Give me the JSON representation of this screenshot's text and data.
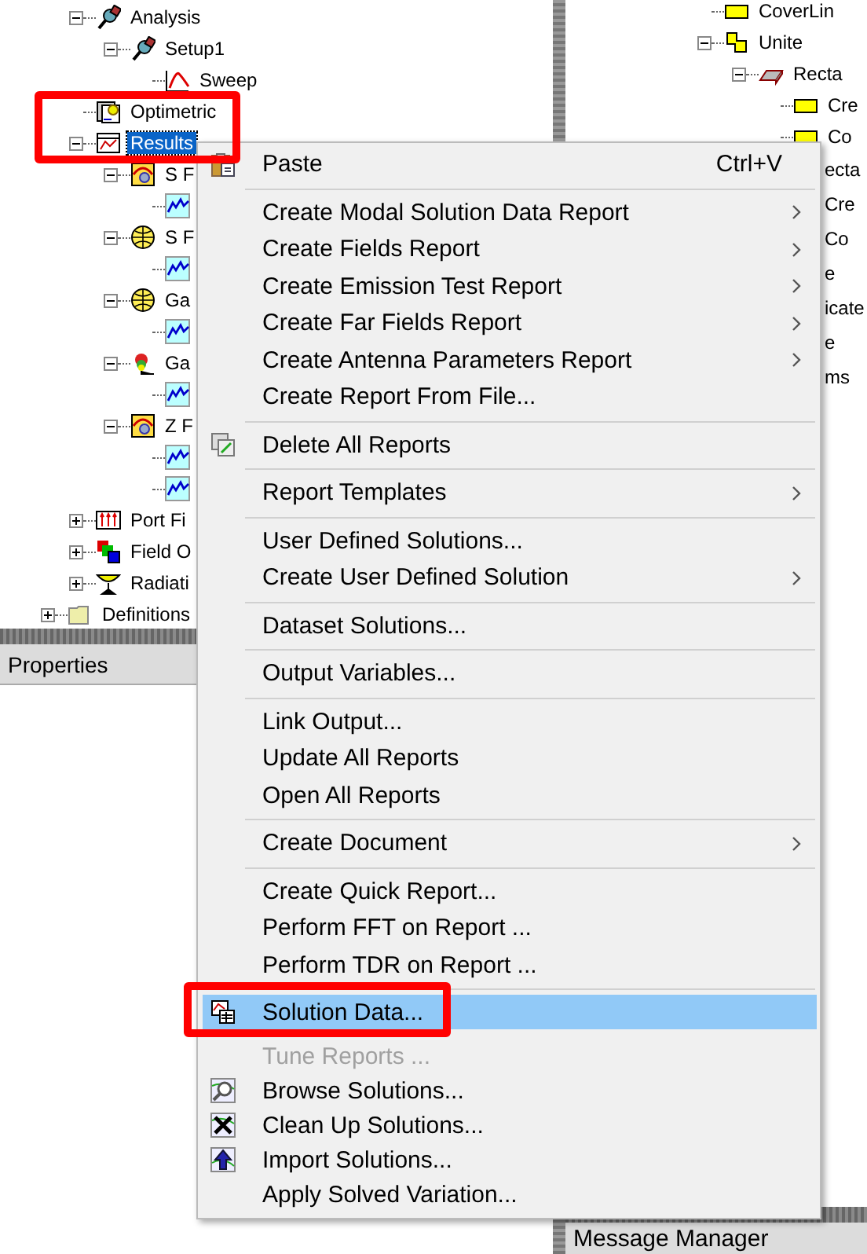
{
  "tree": {
    "items": [
      {
        "label": "Analysis",
        "kind": "probe",
        "expanded": true,
        "selected": false,
        "children": [
          {
            "label": "Setup1",
            "kind": "probe",
            "expanded": true,
            "selected": false,
            "children": [
              {
                "label": "Sweep",
                "kind": "sweep",
                "selected": false
              }
            ]
          }
        ]
      },
      {
        "label": "Optimetric",
        "kind": "optimetrics",
        "selected": false
      },
      {
        "label": "Results",
        "kind": "results",
        "expanded": true,
        "selected": true,
        "children": [
          {
            "label": "S F",
            "kind": "report",
            "expanded": true,
            "selected": false,
            "children": [
              {
                "kind": "plot",
                "selected": false
              }
            ]
          },
          {
            "label": "S F",
            "kind": "ball",
            "expanded": true,
            "selected": false,
            "children": [
              {
                "kind": "plot",
                "selected": false
              }
            ]
          },
          {
            "label": "Ga",
            "kind": "ball",
            "expanded": true,
            "selected": false,
            "children": [
              {
                "kind": "plot",
                "selected": false
              }
            ]
          },
          {
            "label": "Ga",
            "kind": "flower",
            "expanded": true,
            "selected": false,
            "children": [
              {
                "kind": "plot",
                "selected": false
              }
            ]
          },
          {
            "label": "Z F",
            "kind": "report",
            "expanded": true,
            "selected": false,
            "children": [
              {
                "kind": "plot",
                "selected": false
              },
              {
                "kind": "plot",
                "selected": false
              }
            ]
          }
        ]
      },
      {
        "label": "Port Fi",
        "kind": "ports",
        "expanded": false,
        "selected": false
      },
      {
        "label": "Field O",
        "kind": "field",
        "expanded": false,
        "selected": false
      },
      {
        "label": "Radiati",
        "kind": "radiation",
        "expanded": false,
        "selected": false
      }
    ],
    "outer_items": [
      {
        "label": "Definitions",
        "kind": "folder",
        "expanded": false,
        "selected": false
      }
    ]
  },
  "model_tree": {
    "items": [
      {
        "label": "CoverLin",
        "kind": "sheet"
      },
      {
        "label": "Unite",
        "kind": "unite",
        "expanded": true,
        "children": [
          {
            "label": "Recta",
            "kind": "box",
            "expanded": true,
            "children": [
              {
                "label": "Cre",
                "kind": "sheet"
              },
              {
                "label": "Co",
                "kind": "sheet"
              }
            ]
          }
        ]
      }
    ],
    "fragments": [
      "ecta",
      "Cre",
      "Co",
      "e",
      "icate",
      "e",
      "ms"
    ]
  },
  "properties": {
    "title": "Properties"
  },
  "message_manager": {
    "title": "Message Manager"
  },
  "context_menu": [
    {
      "kind": "paste",
      "label": "Paste",
      "shortcut": "Ctrl+V",
      "submenu": false,
      "selected": false,
      "disabled": false
    },
    {
      "kind": "separator"
    },
    {
      "kind": "plain",
      "label": "Create Modal Solution Data Report",
      "submenu": true,
      "selected": false,
      "disabled": false
    },
    {
      "kind": "plain",
      "label": "Create Fields Report",
      "submenu": true,
      "selected": false,
      "disabled": false
    },
    {
      "kind": "plain",
      "label": "Create Emission Test Report",
      "submenu": true,
      "selected": false,
      "disabled": false
    },
    {
      "kind": "plain",
      "label": "Create Far Fields Report",
      "submenu": true,
      "selected": false,
      "disabled": false
    },
    {
      "kind": "plain",
      "label": "Create Antenna Parameters Report",
      "submenu": true,
      "selected": false,
      "disabled": false
    },
    {
      "kind": "plain",
      "label": "Create Report From File...",
      "submenu": false,
      "selected": false,
      "disabled": false
    },
    {
      "kind": "separator"
    },
    {
      "kind": "delete",
      "label": "Delete All Reports",
      "submenu": false,
      "selected": false,
      "disabled": false
    },
    {
      "kind": "separator"
    },
    {
      "kind": "plain",
      "label": "Report Templates",
      "submenu": true,
      "selected": false,
      "disabled": false
    },
    {
      "kind": "separator"
    },
    {
      "kind": "plain",
      "label": "User Defined Solutions...",
      "submenu": false,
      "selected": false,
      "disabled": false
    },
    {
      "kind": "plain",
      "label": "Create User Defined Solution",
      "submenu": true,
      "selected": false,
      "disabled": false
    },
    {
      "kind": "separator"
    },
    {
      "kind": "plain",
      "label": "Dataset Solutions...",
      "submenu": false,
      "selected": false,
      "disabled": false
    },
    {
      "kind": "separator"
    },
    {
      "kind": "plain",
      "label": "Output Variables...",
      "submenu": false,
      "selected": false,
      "disabled": false
    },
    {
      "kind": "separator"
    },
    {
      "kind": "plain",
      "label": "Link Output...",
      "submenu": false,
      "selected": false,
      "disabled": false
    },
    {
      "kind": "plain",
      "label": "Update All Reports",
      "submenu": false,
      "selected": false,
      "disabled": false
    },
    {
      "kind": "plain",
      "label": "Open All Reports",
      "submenu": false,
      "selected": false,
      "disabled": false
    },
    {
      "kind": "separator"
    },
    {
      "kind": "plain",
      "label": "Create Document",
      "submenu": true,
      "selected": false,
      "disabled": false
    },
    {
      "kind": "separator"
    },
    {
      "kind": "plain",
      "label": "Create Quick Report...",
      "submenu": false,
      "selected": false,
      "disabled": false
    },
    {
      "kind": "plain",
      "label": "Perform FFT on Report ...",
      "submenu": false,
      "selected": false,
      "disabled": false
    },
    {
      "kind": "plain",
      "label": "Perform TDR on Report ...",
      "submenu": false,
      "selected": false,
      "disabled": false
    },
    {
      "kind": "separator"
    },
    {
      "kind": "solution",
      "label": "Solution Data...",
      "submenu": false,
      "selected": true,
      "disabled": false
    },
    {
      "kind": "plain",
      "label": "Tune Reports ...",
      "submenu": false,
      "selected": false,
      "disabled": true
    },
    {
      "kind": "browse",
      "label": "Browse Solutions...",
      "submenu": false,
      "selected": false,
      "disabled": false
    },
    {
      "kind": "cleanup",
      "label": "Clean Up Solutions...",
      "submenu": false,
      "selected": false,
      "disabled": false
    },
    {
      "kind": "import",
      "label": "Import Solutions...",
      "submenu": false,
      "selected": false,
      "disabled": false
    },
    {
      "kind": "plain",
      "label": "Apply Solved Variation...",
      "submenu": false,
      "selected": false,
      "disabled": false
    }
  ],
  "annotations": [
    {
      "kind": "box"
    },
    {
      "kind": "box"
    }
  ]
}
